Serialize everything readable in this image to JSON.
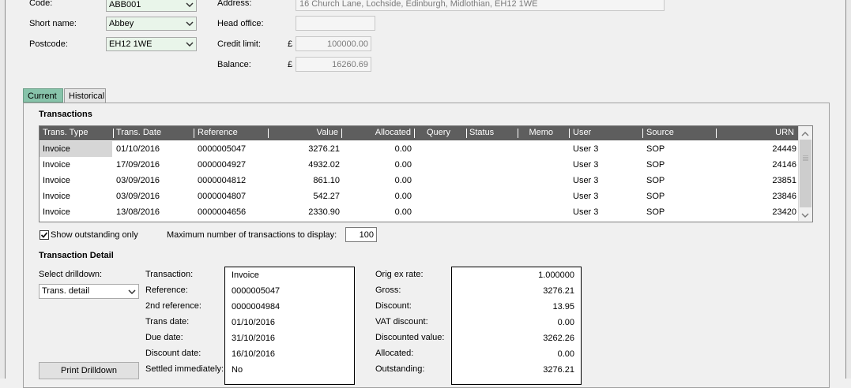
{
  "account": {
    "code_label": "Code:",
    "code_value": "ABB001",
    "short_name_label": "Short name:",
    "short_name_value": "Abbey",
    "postcode_label": "Postcode:",
    "postcode_value": "EH12 1WE",
    "address_label": "Address:",
    "address_value": "16 Church Lane, Lochside, Edinburgh, Midlothian, EH12 1WE",
    "head_office_label": "Head office:",
    "head_office_value": "",
    "credit_limit_label": "Credit limit:",
    "credit_limit_value": "100000.00",
    "balance_label": "Balance:",
    "balance_value": "16260.69",
    "currency_symbol": "£"
  },
  "tabs": [
    {
      "label": "Current",
      "active": true
    },
    {
      "label": "Historical",
      "active": false
    }
  ],
  "transactions": {
    "title": "Transactions",
    "columns": [
      "Trans. Type",
      "Trans. Date",
      "Reference",
      "Value",
      "Allocated",
      "Query",
      "Status",
      "Memo",
      "User",
      "Source",
      "URN"
    ],
    "rows": [
      [
        "Invoice",
        "01/10/2016",
        "0000005047",
        "3276.21",
        "0.00",
        "",
        "",
        "",
        "User 3",
        "SOP",
        "24449"
      ],
      [
        "Invoice",
        "17/09/2016",
        "0000004927",
        "4932.02",
        "0.00",
        "",
        "",
        "",
        "User 3",
        "SOP",
        "24146"
      ],
      [
        "Invoice",
        "03/09/2016",
        "0000004812",
        "861.10",
        "0.00",
        "",
        "",
        "",
        "User 3",
        "SOP",
        "23851"
      ],
      [
        "Invoice",
        "03/09/2016",
        "0000004807",
        "542.27",
        "0.00",
        "",
        "",
        "",
        "User 3",
        "SOP",
        "23846"
      ],
      [
        "Invoice",
        "13/08/2016",
        "0000004656",
        "2330.90",
        "0.00",
        "",
        "",
        "",
        "User 3",
        "SOP",
        "23420"
      ]
    ],
    "show_outstanding_label": "Show outstanding only",
    "show_outstanding_checked": true,
    "max_label": "Maximum number of transactions to display:",
    "max_value": "100"
  },
  "detail": {
    "title": "Transaction Detail",
    "select_label": "Select drilldown:",
    "select_value": "Trans. detail",
    "print_button": "Print Drilldown",
    "left": [
      {
        "label": "Transaction:",
        "value": "Invoice"
      },
      {
        "label": "Reference:",
        "value": "0000005047"
      },
      {
        "label": "2nd reference:",
        "value": "0000004984"
      },
      {
        "label": "Trans date:",
        "value": "01/10/2016"
      },
      {
        "label": "Due date:",
        "value": "31/10/2016"
      },
      {
        "label": "Discount date:",
        "value": "16/10/2016"
      },
      {
        "label": "Settled immediately:",
        "value": "No"
      }
    ],
    "right": [
      {
        "label": "Orig ex rate:",
        "value": "1.000000"
      },
      {
        "label": "Gross:",
        "value": "3276.21"
      },
      {
        "label": "Discount:",
        "value": "13.95"
      },
      {
        "label": "VAT discount:",
        "value": "0.00"
      },
      {
        "label": "Discounted value:",
        "value": "3262.26"
      },
      {
        "label": "Allocated:",
        "value": "0.00"
      },
      {
        "label": "Outstanding:",
        "value": "3276.21"
      }
    ]
  }
}
